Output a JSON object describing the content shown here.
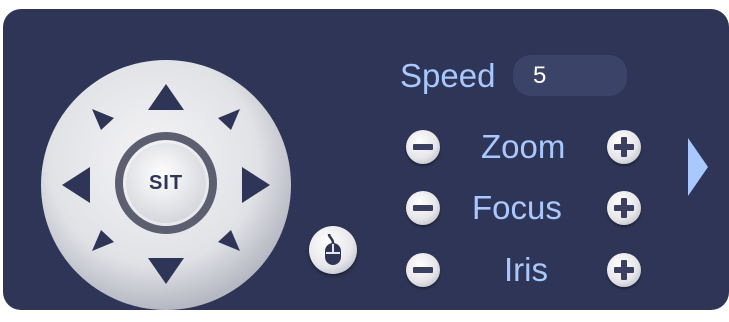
{
  "ptz": {
    "center_label": "SIT",
    "speed_label": "Speed",
    "speed_value": "5",
    "zoom_label": "Zoom",
    "focus_label": "Focus",
    "iris_label": "Iris"
  },
  "colors": {
    "panel_bg": "#2f3556",
    "label_text": "#a8c8ff",
    "arrow_fill": "#2f3556",
    "expand_arrow": "#a8c8ff"
  }
}
